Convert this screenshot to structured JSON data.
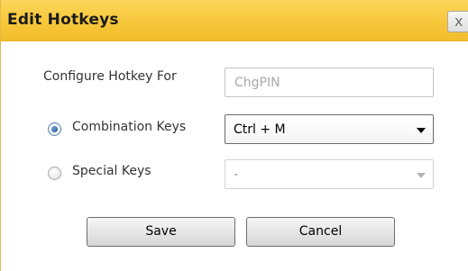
{
  "dialog": {
    "title": "Edit Hotkeys",
    "close_glyph": "x"
  },
  "form": {
    "configure_label": "Configure Hotkey For",
    "configure_value": "ChgPIN",
    "combination": {
      "label": "Combination Keys",
      "selected": true,
      "value": "Ctrl + M",
      "enabled": true
    },
    "special": {
      "label": "Special Keys",
      "selected": false,
      "value": "-",
      "enabled": false
    }
  },
  "buttons": {
    "save": "Save",
    "cancel": "Cancel"
  },
  "colors": {
    "titlebar": "#f7c73a",
    "text": "#333333"
  }
}
